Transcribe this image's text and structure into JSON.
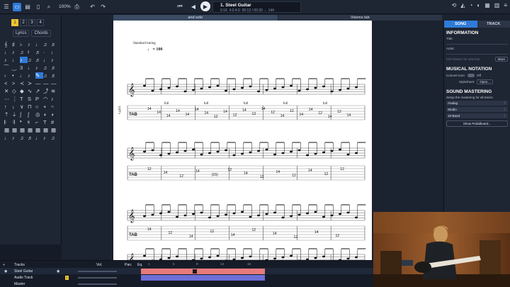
{
  "toolbar": {
    "zoom": "100%",
    "track_title": "1. Steel Guitar",
    "position": "6:16",
    "signature": "4.0:4.0",
    "time": "00:12 / 00:29",
    "tempo": "144"
  },
  "tabs": [
    "and solo",
    "Visions tab"
  ],
  "left_panel": {
    "pages": [
      "1",
      "2",
      "3",
      "4"
    ],
    "lyrics_label": "Lyrics",
    "chords_label": "Chords"
  },
  "score": {
    "tuning": "Standard tuning",
    "tempo": "= 100",
    "instrument": "s.guit.",
    "staff1_bends": [
      "full",
      "full",
      "full",
      "full",
      "full"
    ],
    "staff1_tab": [
      "14",
      "14",
      "14",
      "14",
      "14",
      "14",
      "14",
      "12",
      "14",
      "12",
      "14",
      "13",
      "14",
      "12",
      "14",
      "12",
      "14",
      "14",
      "12",
      "14",
      "12",
      "14"
    ],
    "staff2_tab": [
      "12",
      "14",
      "12",
      "14",
      "(15)",
      "12",
      "14",
      "12",
      "14",
      "12",
      "14",
      "12",
      "12"
    ],
    "staff3_tab": [
      "14",
      "12",
      "14",
      "12",
      "14",
      "12",
      "14",
      "12",
      "14",
      "12"
    ]
  },
  "right_panel": {
    "tab_song": "SONG",
    "tab_track": "TRACK",
    "information": "INFORMATION",
    "title_label": "Title:",
    "artist_label": "Artist:",
    "hint": "Ctrl+Return for new line",
    "more": "More",
    "musical_notation": "MUSICAL NOTATION",
    "concert_tone": "Concert tone:",
    "off": "Off",
    "stylesheet": "Stylesheet:",
    "open": "Open...",
    "sound_mastering": "SOUND MASTERING",
    "setup": "Setup the mastering for all tracks",
    "presets": [
      "Analog",
      "Studio",
      "10-Band"
    ],
    "show_pedalboard": "Show Pedalboard..."
  },
  "track_panel": {
    "tracks_label": "Tracks",
    "vol": "Vol.",
    "pan": "Pan.",
    "eq": "Eq.",
    "tracks": [
      "Steel Guitar",
      "Audio Track",
      "Master"
    ],
    "ruler": [
      "1",
      "5",
      "9",
      "13",
      "16"
    ]
  },
  "colors": {
    "accent": "#2f7bd8",
    "guitar_lane": "#e77b7b",
    "audio_lane": "#6d6fd8"
  }
}
